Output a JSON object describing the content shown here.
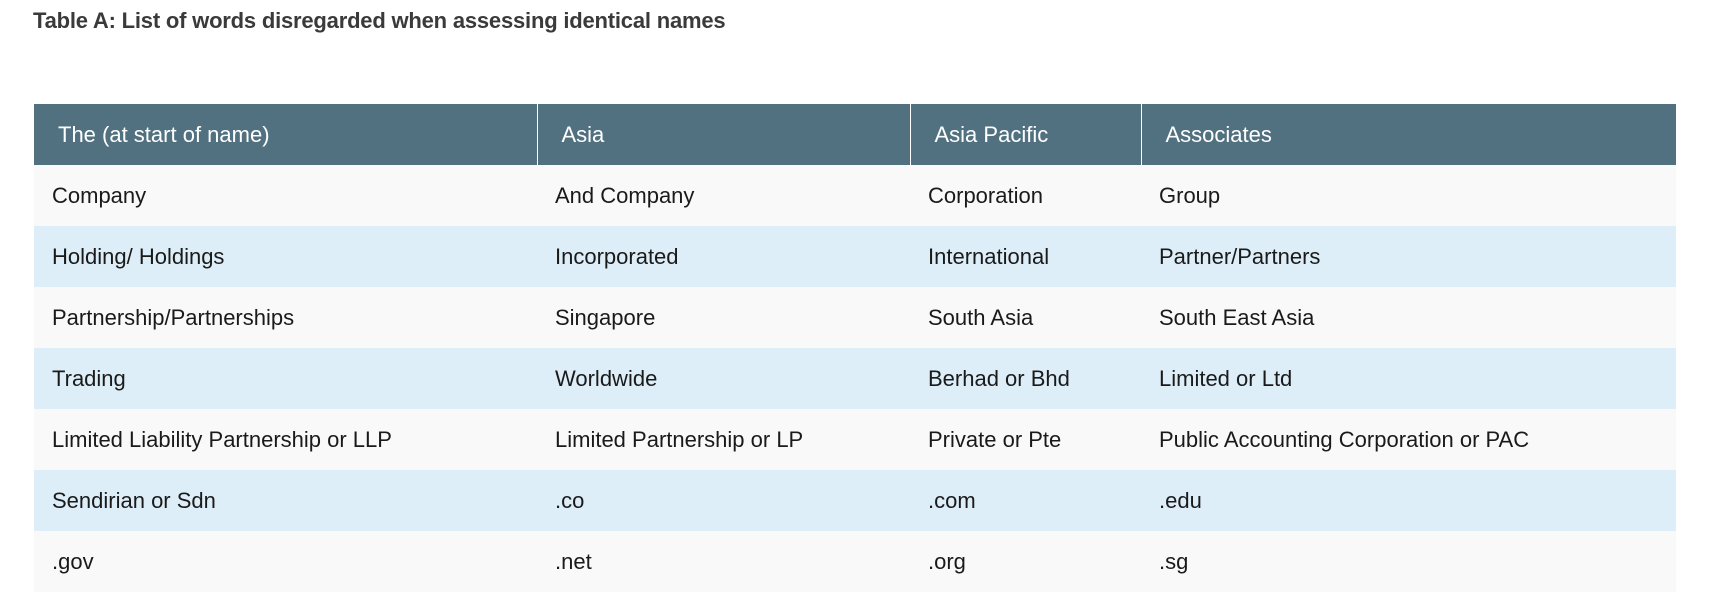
{
  "title": "Table A: List of words disregarded when assessing identical names",
  "table": {
    "headers": [
      "The (at start of name)",
      "Asia",
      "Asia Pacific",
      "Associates"
    ],
    "rows": [
      [
        "Company",
        "And Company",
        "Corporation",
        "Group"
      ],
      [
        "Holding/ Holdings",
        "Incorporated",
        "International",
        "Partner/Partners"
      ],
      [
        "Partnership/Partnerships",
        "Singapore",
        "South Asia",
        "South East Asia"
      ],
      [
        "Trading",
        "Worldwide",
        "Berhad or Bhd",
        "Limited or Ltd"
      ],
      [
        "Limited Liability Partnership or LLP",
        "Limited Partnership or LP",
        "Private or Pte",
        "Public Accounting Corporation or PAC"
      ],
      [
        "Sendirian or Sdn",
        ".co",
        ".com",
        ".edu"
      ],
      [
        ".gov",
        ".net",
        ".org",
        ".sg"
      ]
    ]
  }
}
